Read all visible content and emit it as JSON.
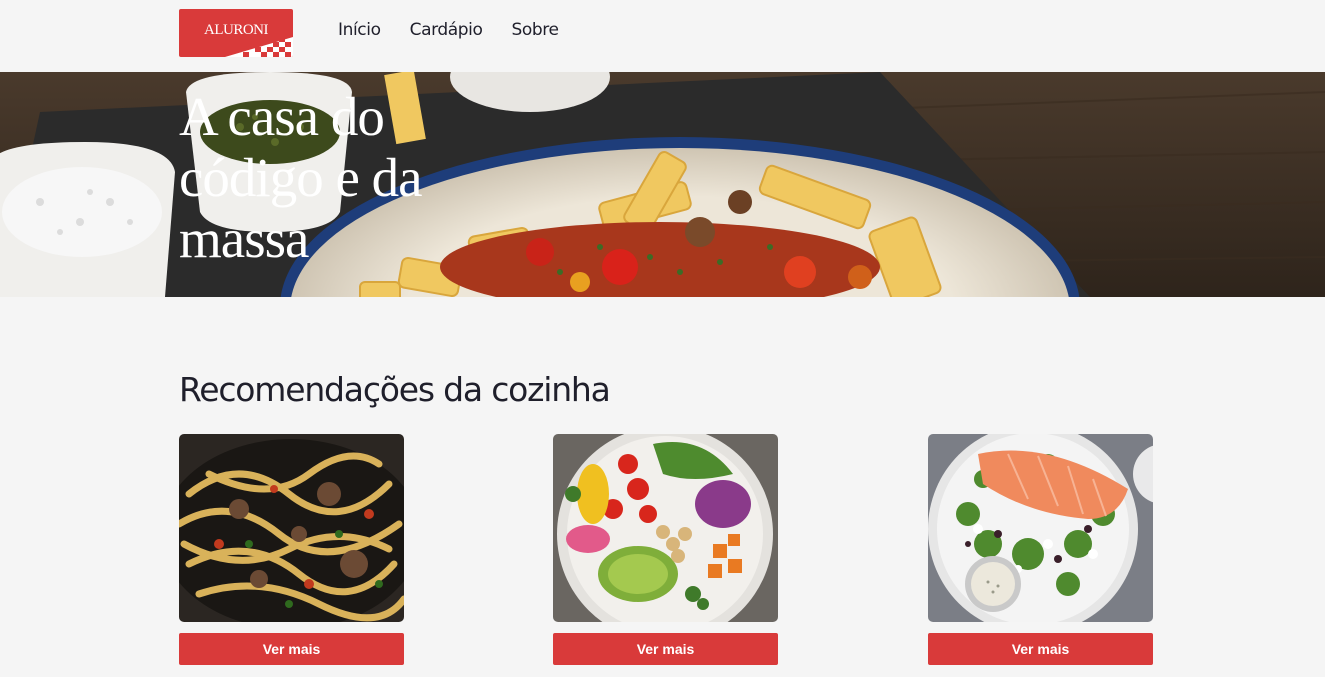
{
  "header": {
    "logo_text": "ALURONI",
    "nav": [
      "Início",
      "Cardápio",
      "Sobre"
    ]
  },
  "hero": {
    "title": "A casa do código e da massa"
  },
  "recommendations": {
    "title": "Recomendações da cozinha",
    "cards": [
      {
        "image": "pasta-with-meat-dish",
        "button_label": "Ver mais"
      },
      {
        "image": "salad-bowl-dish",
        "button_label": "Ver mais"
      },
      {
        "image": "salmon-salad-dish",
        "button_label": "Ver mais"
      }
    ]
  },
  "colors": {
    "accent": "#d93a3a",
    "background": "#f5f5f5",
    "text": "#1f1f2b"
  }
}
